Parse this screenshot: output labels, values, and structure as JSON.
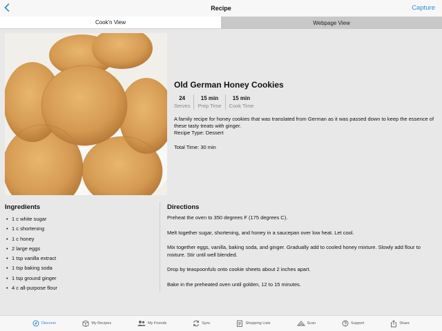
{
  "nav": {
    "title": "Recipe",
    "capture_label": "Capture",
    "back_icon": "chevron-left-icon"
  },
  "segments": [
    {
      "label": "Cook'n View",
      "selected": true
    },
    {
      "label": "Webpage View",
      "selected": false
    }
  ],
  "recipe": {
    "title": "Old German Honey Cookies",
    "stats": [
      {
        "value": "24",
        "label": "Serves"
      },
      {
        "value": "15 min",
        "label": "Prep Time"
      },
      {
        "value": "15 min",
        "label": "Cook Time"
      }
    ],
    "description": "A family recipe for honey cookies that was translated from German as it was passed down to keep the essence of these tasty treats with ginger.",
    "recipe_type": "Recipe Type: Dessert",
    "total_time": "Total Time: 30 min"
  },
  "ingredients": {
    "heading": "Ingredients",
    "items": [
      "1 c white sugar",
      "1 c shortening",
      "1 c honey",
      "2 large eggs",
      "1 tsp vanilla extract",
      "1 tsp baking soda",
      "1 tsp ground ginger",
      "4 c all-purpose flour"
    ]
  },
  "directions": {
    "heading": "Directions",
    "steps": [
      "Preheat the oven to 350 degrees F (175 degrees C).",
      "Melt together sugar, shortening, and honey in a saucepan over low heat. Let cool.",
      "Mix together eggs, vanilla, baking soda, and ginger. Gradually add to cooled honey mixture. Slowly add flour to mixture. Stir until well blended.",
      "Drop by teaspoonfuls onto cookie sheets about 2 inches apart.",
      "Bake in the preheated oven until golden, 12 to 15 minutes."
    ]
  },
  "tabbar": [
    {
      "label": "Discover",
      "icon": "discover-icon",
      "active": true
    },
    {
      "label": "My Recipes",
      "icon": "recipe-box-icon",
      "active": false
    },
    {
      "label": "My Friends",
      "icon": "friends-icon",
      "active": false
    },
    {
      "label": "Sync",
      "icon": "sync-icon",
      "active": false
    },
    {
      "label": "Shopping Lists",
      "icon": "shopping-list-icon",
      "active": false
    },
    {
      "label": "Scan",
      "icon": "scan-icon",
      "active": false
    },
    {
      "label": "Support",
      "icon": "support-icon",
      "active": false
    },
    {
      "label": "Share",
      "icon": "share-icon",
      "active": false
    }
  ],
  "colors": {
    "accent": "#2e8bd6",
    "background": "#e8e8e8",
    "segment_inactive": "#c8c8c8"
  }
}
